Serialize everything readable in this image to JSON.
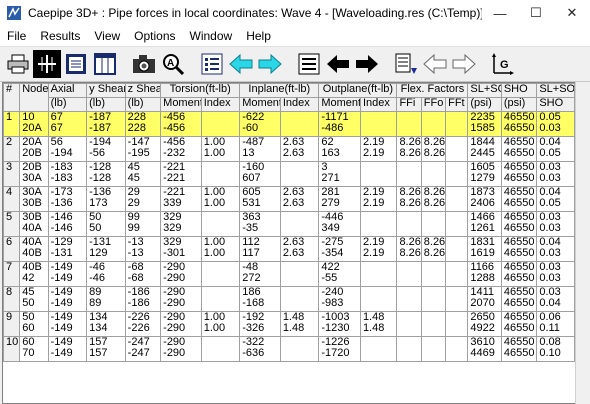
{
  "window": {
    "title": "Caepipe 3D+ : Pipe forces in local coordinates: Wave 4 -  [Waveloading.res (C:\\Temp)]",
    "minimize": "—",
    "maximize": "☐",
    "close": "✕"
  },
  "menu": [
    "File",
    "Results",
    "View",
    "Options",
    "Window",
    "Help"
  ],
  "toolbar": {
    "icons": [
      "print-icon",
      "grid-icon",
      "list-view-icon",
      "columns-icon",
      "camera-icon",
      "zoom-icon",
      "list-icon",
      "arrow-left-cyan-icon",
      "arrow-right-cyan-icon",
      "menu-lines-icon",
      "arrow-left-black-icon",
      "arrow-right-black-icon",
      "sort-down-icon",
      "arrow-left-outline-icon",
      "arrow-right-outline-icon",
      "global-axes-icon"
    ],
    "global_label": "G"
  },
  "table": {
    "group_headers": {
      "torsion": "Torsion(ft-lb)",
      "inplane": "Inplane(ft-lb)",
      "outplane": "Outplane(ft-lb)",
      "flex": "Flex. Factors"
    },
    "col_headers": {
      "num": "#",
      "node": "Node",
      "axial": "Axial",
      "yshear": "y Shear",
      "zshear": "z Shear",
      "t_moment": "Moment",
      "t_index": "Index",
      "i_moment": "Moment",
      "i_index": "Index",
      "o_moment": "Moment",
      "o_index": "Index",
      "ffi": "FFi",
      "ffo": "FFo",
      "fft": "FFt",
      "sl_so": "SL+SO",
      "sho": "SHO",
      "sl_so_ratio": "SL+SO"
    },
    "unit_headers": {
      "axial": "(lb)",
      "yshear": "(lb)",
      "zshear": "(lb)",
      "sl_so": "(psi)",
      "sho": "(psi)",
      "sl_so_ratio": "SHO"
    },
    "rows": [
      {
        "num": "1",
        "node": [
          "10",
          "20A"
        ],
        "axial": [
          "67",
          "67"
        ],
        "yshear": [
          "-187",
          "-187"
        ],
        "zshear": [
          "228",
          "228"
        ],
        "t_moment": [
          "-456",
          "-456"
        ],
        "t_index": [
          "",
          ""
        ],
        "i_moment": [
          "-622",
          "-60"
        ],
        "i_index": [
          "",
          ""
        ],
        "o_moment": [
          "-1171",
          "-486"
        ],
        "o_index": [
          "",
          ""
        ],
        "ffi": [
          "",
          ""
        ],
        "ffo": [
          "",
          ""
        ],
        "fft": [
          "",
          ""
        ],
        "sl_so": [
          "2235",
          "1585"
        ],
        "sho": [
          "46550",
          "46550"
        ],
        "ratio": [
          "0.05",
          "0.03"
        ],
        "highlight": true
      },
      {
        "num": "2",
        "node": [
          "20A",
          "20B"
        ],
        "axial": [
          "56",
          "-194"
        ],
        "yshear": [
          "-194",
          "-56"
        ],
        "zshear": [
          "-147",
          "-195"
        ],
        "t_moment": [
          "-456",
          "-232"
        ],
        "t_index": [
          "1.00",
          "1.00"
        ],
        "i_moment": [
          "-487",
          "13"
        ],
        "i_index": [
          "2.63",
          "2.63"
        ],
        "o_moment": [
          "62",
          "163"
        ],
        "o_index": [
          "2.19",
          "2.19"
        ],
        "ffi": [
          "8.26",
          "8.26"
        ],
        "ffo": [
          "8.26",
          "8.26"
        ],
        "fft": [
          "",
          ""
        ],
        "sl_so": [
          "1844",
          "2445"
        ],
        "sho": [
          "46550",
          "46550"
        ],
        "ratio": [
          "0.04",
          "0.05"
        ],
        "highlight": false
      },
      {
        "num": "3",
        "node": [
          "20B",
          "30A"
        ],
        "axial": [
          "-183",
          "-183"
        ],
        "yshear": [
          "-128",
          "-128"
        ],
        "zshear": [
          "45",
          "45"
        ],
        "t_moment": [
          "-221",
          "-221"
        ],
        "t_index": [
          "",
          ""
        ],
        "i_moment": [
          "-160",
          "607"
        ],
        "i_index": [
          "",
          ""
        ],
        "o_moment": [
          "3",
          "271"
        ],
        "o_index": [
          "",
          ""
        ],
        "ffi": [
          "",
          ""
        ],
        "ffo": [
          "",
          ""
        ],
        "fft": [
          "",
          ""
        ],
        "sl_so": [
          "1605",
          "1279"
        ],
        "sho": [
          "46550",
          "46550"
        ],
        "ratio": [
          "0.03",
          "0.03"
        ],
        "highlight": false
      },
      {
        "num": "4",
        "node": [
          "30A",
          "30B"
        ],
        "axial": [
          "-173",
          "-136"
        ],
        "yshear": [
          "-136",
          "173"
        ],
        "zshear": [
          "29",
          "29"
        ],
        "t_moment": [
          "-221",
          "339"
        ],
        "t_index": [
          "1.00",
          "1.00"
        ],
        "i_moment": [
          "605",
          "531"
        ],
        "i_index": [
          "2.63",
          "2.63"
        ],
        "o_moment": [
          "281",
          "279"
        ],
        "o_index": [
          "2.19",
          "2.19"
        ],
        "ffi": [
          "8.26",
          "8.26"
        ],
        "ffo": [
          "8.26",
          "8.26"
        ],
        "fft": [
          "",
          ""
        ],
        "sl_so": [
          "1873",
          "2406"
        ],
        "sho": [
          "46550",
          "46550"
        ],
        "ratio": [
          "0.04",
          "0.05"
        ],
        "highlight": false
      },
      {
        "num": "5",
        "node": [
          "30B",
          "40A"
        ],
        "axial": [
          "-146",
          "-146"
        ],
        "yshear": [
          "50",
          "50"
        ],
        "zshear": [
          "99",
          "99"
        ],
        "t_moment": [
          "329",
          "329"
        ],
        "t_index": [
          "",
          ""
        ],
        "i_moment": [
          "363",
          "-35"
        ],
        "i_index": [
          "",
          ""
        ],
        "o_moment": [
          "-446",
          "349"
        ],
        "o_index": [
          "",
          ""
        ],
        "ffi": [
          "",
          ""
        ],
        "ffo": [
          "",
          ""
        ],
        "fft": [
          "",
          ""
        ],
        "sl_so": [
          "1466",
          "1261"
        ],
        "sho": [
          "46550",
          "46550"
        ],
        "ratio": [
          "0.03",
          "0.03"
        ],
        "highlight": false
      },
      {
        "num": "6",
        "node": [
          "40A",
          "40B"
        ],
        "axial": [
          "-129",
          "-131"
        ],
        "yshear": [
          "-131",
          "129"
        ],
        "zshear": [
          "-13",
          "-13"
        ],
        "t_moment": [
          "329",
          "-301"
        ],
        "t_index": [
          "1.00",
          "1.00"
        ],
        "i_moment": [
          "112",
          "117"
        ],
        "i_index": [
          "2.63",
          "2.63"
        ],
        "o_moment": [
          "-275",
          "-354"
        ],
        "o_index": [
          "2.19",
          "2.19"
        ],
        "ffi": [
          "8.26",
          "8.26"
        ],
        "ffo": [
          "8.26",
          "8.26"
        ],
        "fft": [
          "",
          ""
        ],
        "sl_so": [
          "1831",
          "1619"
        ],
        "sho": [
          "46550",
          "46550"
        ],
        "ratio": [
          "0.04",
          "0.03"
        ],
        "highlight": false
      },
      {
        "num": "7",
        "node": [
          "40B",
          "42"
        ],
        "axial": [
          "-149",
          "-149"
        ],
        "yshear": [
          "-46",
          "-46"
        ],
        "zshear": [
          "-68",
          "-68"
        ],
        "t_moment": [
          "-290",
          "-290"
        ],
        "t_index": [
          "",
          ""
        ],
        "i_moment": [
          "-48",
          "272"
        ],
        "i_index": [
          "",
          ""
        ],
        "o_moment": [
          "422",
          "-55"
        ],
        "o_index": [
          "",
          ""
        ],
        "ffi": [
          "",
          ""
        ],
        "ffo": [
          "",
          ""
        ],
        "fft": [
          "",
          ""
        ],
        "sl_so": [
          "1166",
          "1288"
        ],
        "sho": [
          "46550",
          "46550"
        ],
        "ratio": [
          "0.03",
          "0.03"
        ],
        "highlight": false
      },
      {
        "num": "8",
        "node": [
          "45",
          "50"
        ],
        "axial": [
          "-149",
          "-149"
        ],
        "yshear": [
          "89",
          "89"
        ],
        "zshear": [
          "-186",
          "-186"
        ],
        "t_moment": [
          "-290",
          "-290"
        ],
        "t_index": [
          "",
          ""
        ],
        "i_moment": [
          "186",
          "-168"
        ],
        "i_index": [
          "",
          ""
        ],
        "o_moment": [
          "-240",
          "-983"
        ],
        "o_index": [
          "",
          ""
        ],
        "ffi": [
          "",
          ""
        ],
        "ffo": [
          "",
          ""
        ],
        "fft": [
          "",
          ""
        ],
        "sl_so": [
          "1411",
          "2070"
        ],
        "sho": [
          "46550",
          "46550"
        ],
        "ratio": [
          "0.03",
          "0.04"
        ],
        "highlight": false
      },
      {
        "num": "9",
        "node": [
          "50",
          "60"
        ],
        "axial": [
          "-149",
          "-149"
        ],
        "yshear": [
          "134",
          "134"
        ],
        "zshear": [
          "-226",
          "-226"
        ],
        "t_moment": [
          "-290",
          "-290"
        ],
        "t_index": [
          "1.00",
          "1.00"
        ],
        "i_moment": [
          "-192",
          "-326"
        ],
        "i_index": [
          "1.48",
          "1.48"
        ],
        "o_moment": [
          "-1003",
          "-1230"
        ],
        "o_index": [
          "1.48",
          "1.48"
        ],
        "ffi": [
          "",
          ""
        ],
        "ffo": [
          "",
          ""
        ],
        "fft": [
          "",
          ""
        ],
        "sl_so": [
          "2650",
          "4922"
        ],
        "sho": [
          "46550",
          "46550"
        ],
        "ratio": [
          "0.06",
          "0.11"
        ],
        "highlight": false
      },
      {
        "num": "10",
        "node": [
          "60",
          "70"
        ],
        "axial": [
          "-149",
          "-149"
        ],
        "yshear": [
          "157",
          "157"
        ],
        "zshear": [
          "-247",
          "-247"
        ],
        "t_moment": [
          "-290",
          "-290"
        ],
        "t_index": [
          "",
          ""
        ],
        "i_moment": [
          "-322",
          "-636"
        ],
        "i_index": [
          "",
          ""
        ],
        "o_moment": [
          "-1226",
          "-1720"
        ],
        "o_index": [
          "",
          ""
        ],
        "ffi": [
          "",
          ""
        ],
        "ffo": [
          "",
          ""
        ],
        "fft": [
          "",
          ""
        ],
        "sl_so": [
          "3610",
          "4469"
        ],
        "sho": [
          "46550",
          "46550"
        ],
        "ratio": [
          "0.08",
          "0.10"
        ],
        "highlight": false
      }
    ]
  },
  "colors": {
    "highlight": "#ffff66",
    "cyan_arrow": "#2bd6e6",
    "header_bg": "#f0f0f0"
  }
}
